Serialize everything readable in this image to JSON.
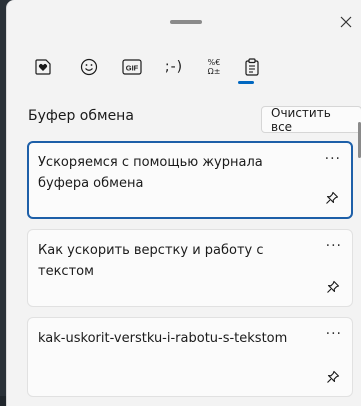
{
  "tabs": [
    {
      "name": "kaomoji-heart-tab",
      "icon": "heart-sticker-icon"
    },
    {
      "name": "emoji-tab",
      "icon": "smiley-icon"
    },
    {
      "name": "gif-tab",
      "icon": "gif-icon",
      "label": "GIF"
    },
    {
      "name": "kaomoji-tab",
      "icon": "kaomoji-icon",
      "label": ";-)"
    },
    {
      "name": "symbols-tab",
      "icon": "symbols-icon",
      "label": "%€\nΩ±"
    },
    {
      "name": "clipboard-tab",
      "icon": "clipboard-icon",
      "active": true
    }
  ],
  "clipboard": {
    "title": "Буфер обмена",
    "clear_all": "Очистить все",
    "more_label": "···",
    "items": [
      {
        "text": "Ускоряемся с помощью журнала буфера обмена",
        "selected": true
      },
      {
        "text": "Как ускорить верстку и работу с текстом",
        "selected": false
      },
      {
        "text": "kak-uskorit-verstku-i-rabotu-s-tekstom",
        "selected": false
      }
    ]
  },
  "colors": {
    "accent": "#0067c0",
    "selected_border": "#1d5fa8",
    "panel_bg": "#f3f3f3"
  }
}
